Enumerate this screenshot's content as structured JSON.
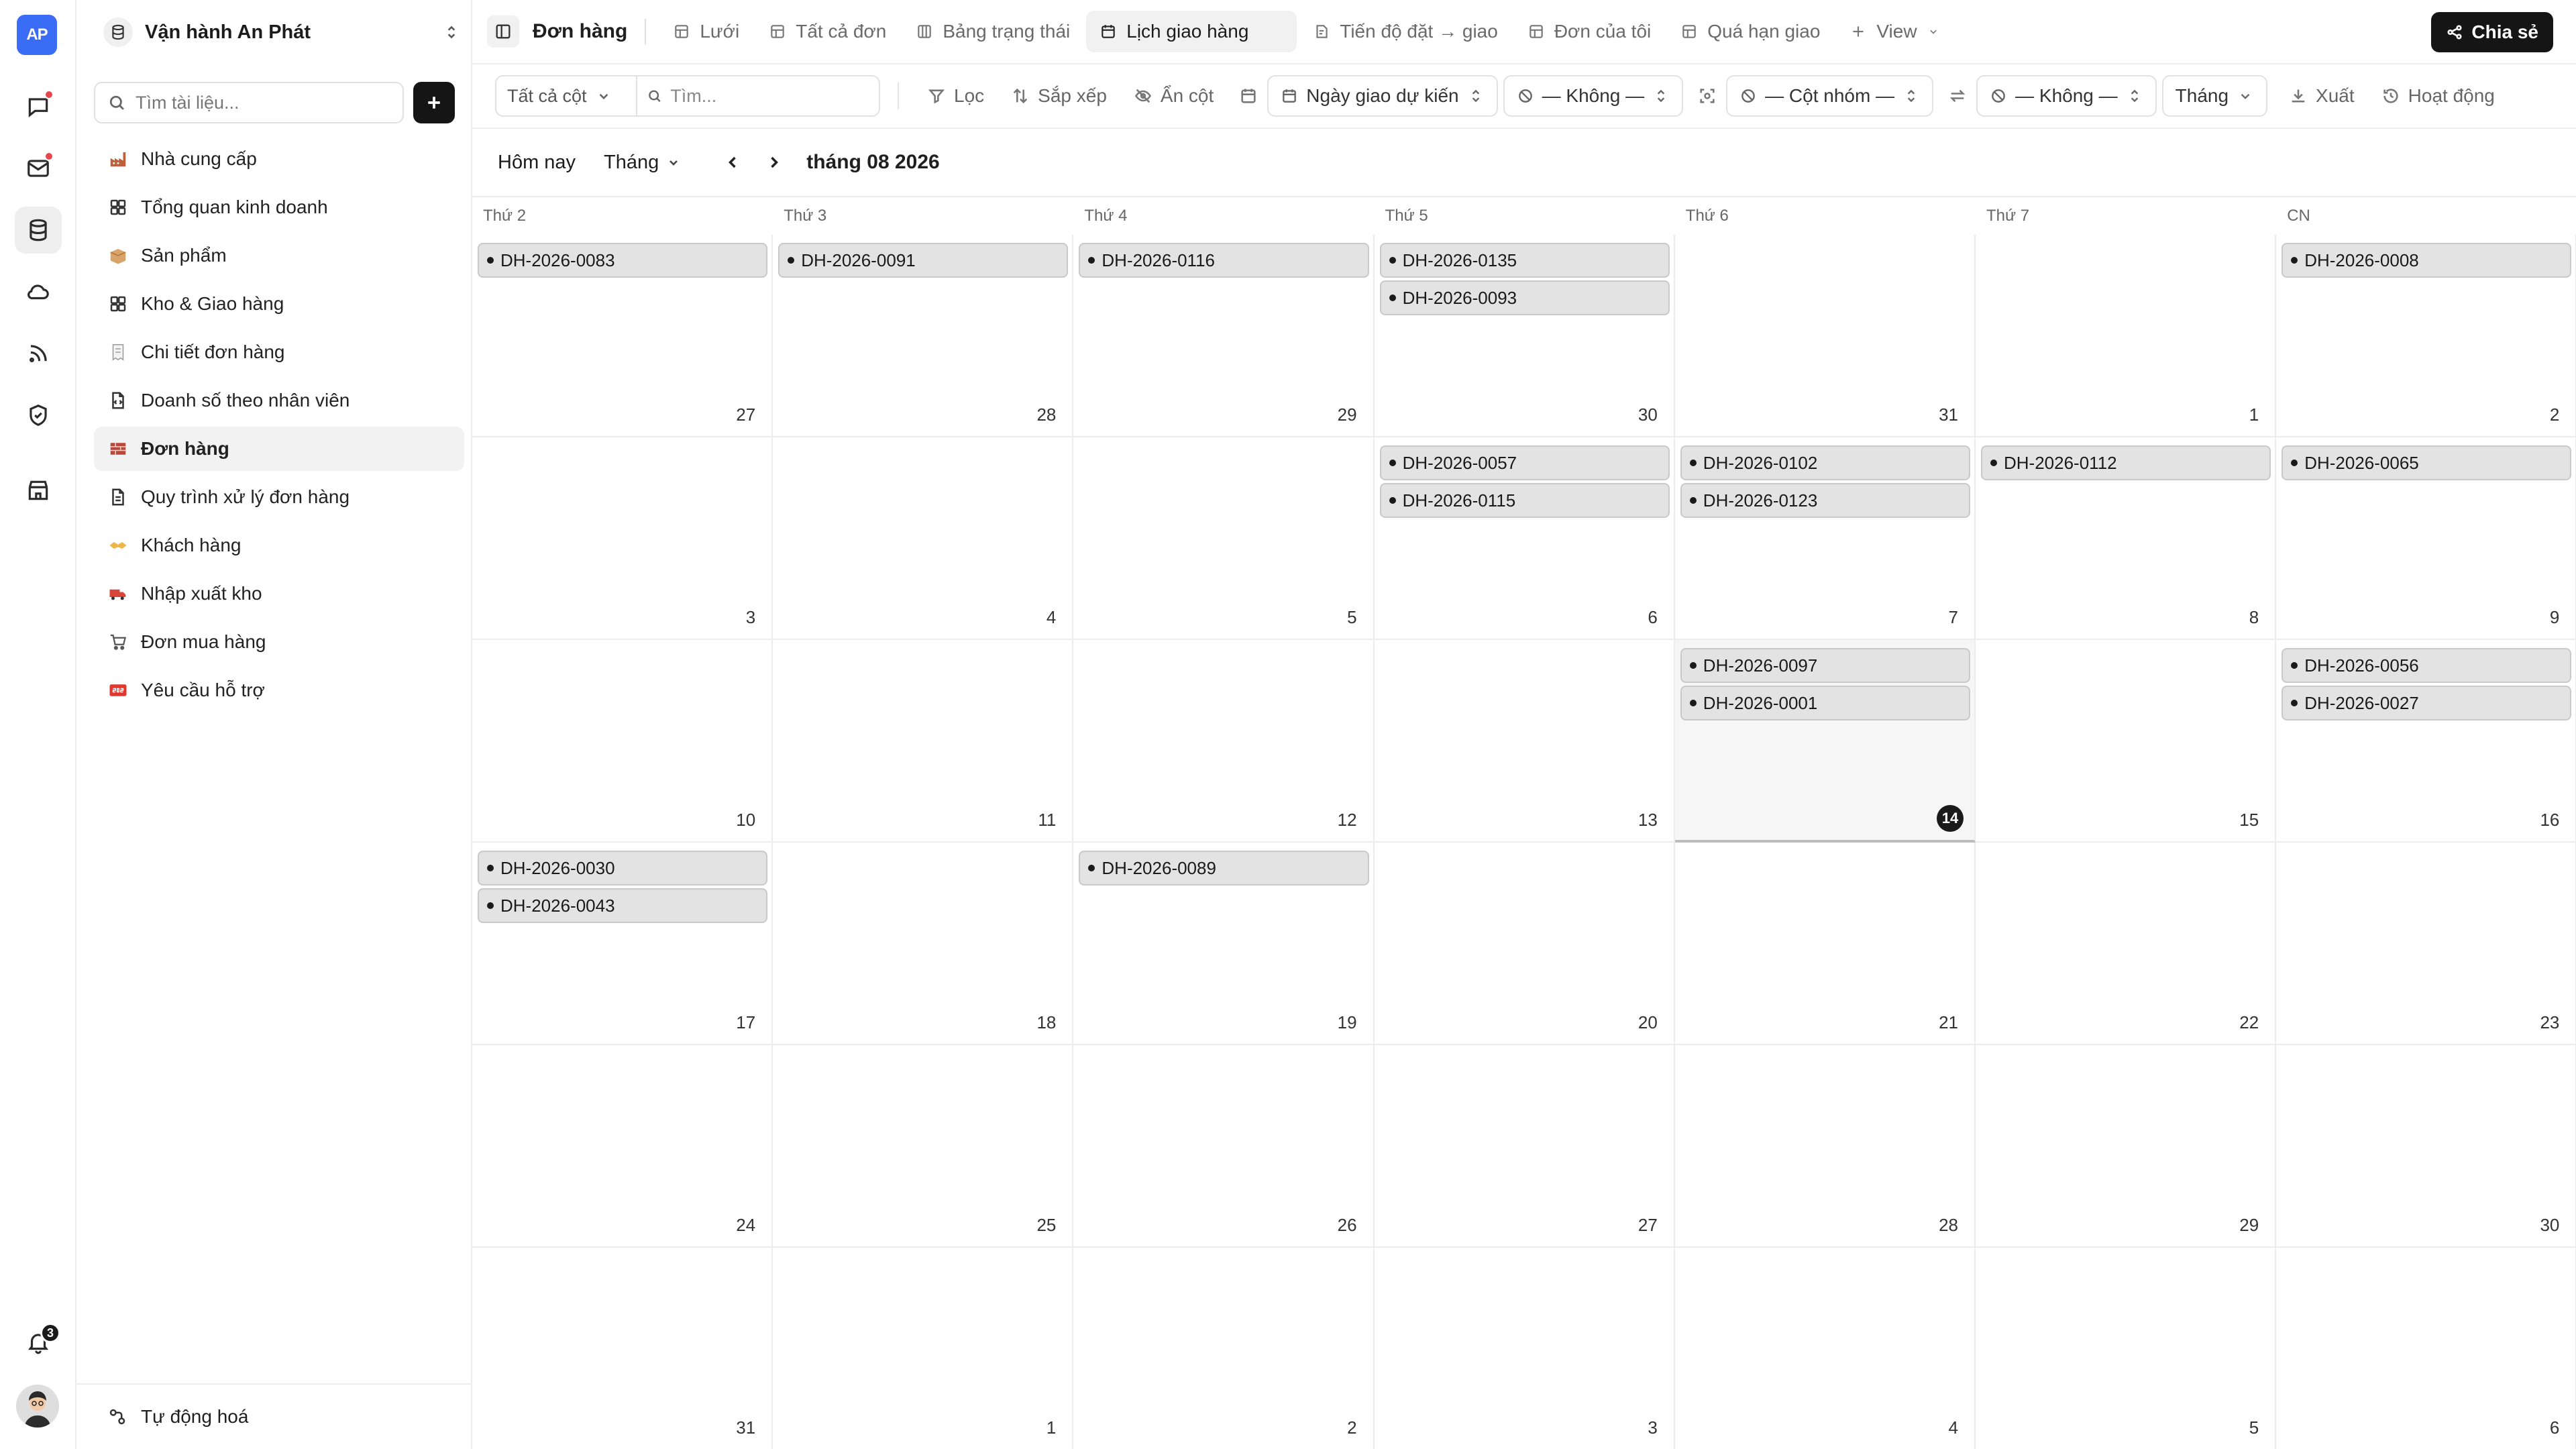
{
  "rail": {
    "logo": "AP",
    "items": [
      {
        "icon": "chat-icon",
        "dot": true
      },
      {
        "icon": "mail-icon",
        "dot": true
      },
      {
        "icon": "database-icon",
        "dot": false,
        "active": true
      },
      {
        "icon": "cloud-icon",
        "dot": false
      },
      {
        "icon": "rss-icon",
        "dot": false
      },
      {
        "icon": "shield-icon",
        "dot": false
      },
      {
        "icon": "store-icon",
        "dot": false
      }
    ],
    "notifications_count": "3"
  },
  "sidebar": {
    "workspace_title": "Vận hành An Phát",
    "search_placeholder": "Tìm tài liệu...",
    "items": [
      {
        "label": "Nhà cung cấp",
        "icon": "factory-emoji-icon",
        "active": false
      },
      {
        "label": "Tổng quan kinh doanh",
        "icon": "dashboard-grid-icon",
        "active": false
      },
      {
        "label": "Sản phẩm",
        "icon": "box-emoji-icon",
        "active": false
      },
      {
        "label": "Kho & Giao hàng",
        "icon": "dashboard-grid-icon",
        "active": false
      },
      {
        "label": "Chi tiết đơn hàng",
        "icon": "receipt-emoji-icon",
        "active": false
      },
      {
        "label": "Doanh số theo nhân viên",
        "icon": "code-file-icon",
        "active": false
      },
      {
        "label": "Đơn hàng",
        "icon": "bricks-emoji-icon",
        "active": true
      },
      {
        "label": "Quy trình xử lý đơn hàng",
        "icon": "document-icon",
        "active": false
      },
      {
        "label": "Khách hàng",
        "icon": "handshake-emoji-icon",
        "active": false
      },
      {
        "label": "Nhập xuất kho",
        "icon": "truck-emoji-icon",
        "active": false
      },
      {
        "label": "Đơn mua hàng",
        "icon": "cart-emoji-icon",
        "active": false
      },
      {
        "label": "Yêu cầu hỗ trợ",
        "icon": "sos-emoji-icon",
        "active": false
      }
    ],
    "automation_label": "Tự động hoá"
  },
  "tabs": {
    "title": "Đơn hàng",
    "items": [
      {
        "label": "Lưới",
        "icon": "table-icon",
        "active": false
      },
      {
        "label": "Tất cả đơn",
        "icon": "table-icon",
        "active": false
      },
      {
        "label": "Bảng trạng thái",
        "icon": "kanban-icon",
        "active": false
      },
      {
        "label": "Lịch giao hàng",
        "icon": "calendar-icon",
        "active": true
      },
      {
        "label": "Tiến độ đặt → giao",
        "icon": "timeline-icon",
        "active": false
      },
      {
        "label": "Đơn của tôi",
        "icon": "table-icon",
        "active": false
      },
      {
        "label": "Quá hạn giao",
        "icon": "table-icon",
        "active": false
      }
    ],
    "add_view_label": "View",
    "share_label": "Chia sẻ"
  },
  "toolbar": {
    "columns_select": "Tất cả cột",
    "search_placeholder": "Tìm...",
    "filter_label": "Lọc",
    "sort_label": "Sắp xếp",
    "hide_columns_label": "Ẩn cột",
    "date_field": "Ngày giao dự kiến",
    "end_field": "— Không —",
    "group_field": "— Cột nhóm —",
    "swap_field": "— Không —",
    "period": "Tháng",
    "export_label": "Xuất",
    "activity_label": "Hoạt động"
  },
  "calendar": {
    "today_label": "Hôm nay",
    "mode": "Tháng",
    "month_title": "tháng 08 2026",
    "weekdays": [
      "Thứ 2",
      "Thứ 3",
      "Thứ 4",
      "Thứ 5",
      "Thứ 6",
      "Thứ 7",
      "CN"
    ],
    "today_day": "14",
    "weeks": [
      [
        {
          "day": "27",
          "events": [
            "DH-2026-0083"
          ]
        },
        {
          "day": "28",
          "events": [
            "DH-2026-0091"
          ]
        },
        {
          "day": "29",
          "events": [
            "DH-2026-0116"
          ]
        },
        {
          "day": "30",
          "events": [
            "DH-2026-0135",
            "DH-2026-0093"
          ]
        },
        {
          "day": "31",
          "events": []
        },
        {
          "day": "1",
          "events": []
        },
        {
          "day": "2",
          "events": [
            "DH-2026-0008"
          ]
        }
      ],
      [
        {
          "day": "3",
          "events": []
        },
        {
          "day": "4",
          "events": []
        },
        {
          "day": "5",
          "events": []
        },
        {
          "day": "6",
          "events": [
            "DH-2026-0057",
            "DH-2026-0115"
          ]
        },
        {
          "day": "7",
          "events": [
            "DH-2026-0102",
            "DH-2026-0123"
          ]
        },
        {
          "day": "8",
          "events": [
            "DH-2026-0112"
          ]
        },
        {
          "day": "9",
          "events": [
            "DH-2026-0065"
          ]
        }
      ],
      [
        {
          "day": "10",
          "events": []
        },
        {
          "day": "11",
          "events": []
        },
        {
          "day": "12",
          "events": []
        },
        {
          "day": "13",
          "events": []
        },
        {
          "day": "14",
          "events": [
            "DH-2026-0097",
            "DH-2026-0001"
          ],
          "today": true
        },
        {
          "day": "15",
          "events": []
        },
        {
          "day": "16",
          "events": [
            "DH-2026-0056",
            "DH-2026-0027"
          ]
        }
      ],
      [
        {
          "day": "17",
          "events": [
            "DH-2026-0030",
            "DH-2026-0043"
          ]
        },
        {
          "day": "18",
          "events": []
        },
        {
          "day": "19",
          "events": [
            "DH-2026-0089"
          ]
        },
        {
          "day": "20",
          "events": []
        },
        {
          "day": "21",
          "events": []
        },
        {
          "day": "22",
          "events": []
        },
        {
          "day": "23",
          "events": []
        }
      ],
      [
        {
          "day": "24",
          "events": []
        },
        {
          "day": "25",
          "events": []
        },
        {
          "day": "26",
          "events": []
        },
        {
          "day": "27",
          "events": []
        },
        {
          "day": "28",
          "events": []
        },
        {
          "day": "29",
          "events": []
        },
        {
          "day": "30",
          "events": []
        }
      ],
      [
        {
          "day": "31",
          "events": []
        },
        {
          "day": "1",
          "events": []
        },
        {
          "day": "2",
          "events": []
        },
        {
          "day": "3",
          "events": []
        },
        {
          "day": "4",
          "events": []
        },
        {
          "day": "5",
          "events": []
        },
        {
          "day": "6",
          "events": []
        }
      ]
    ]
  }
}
